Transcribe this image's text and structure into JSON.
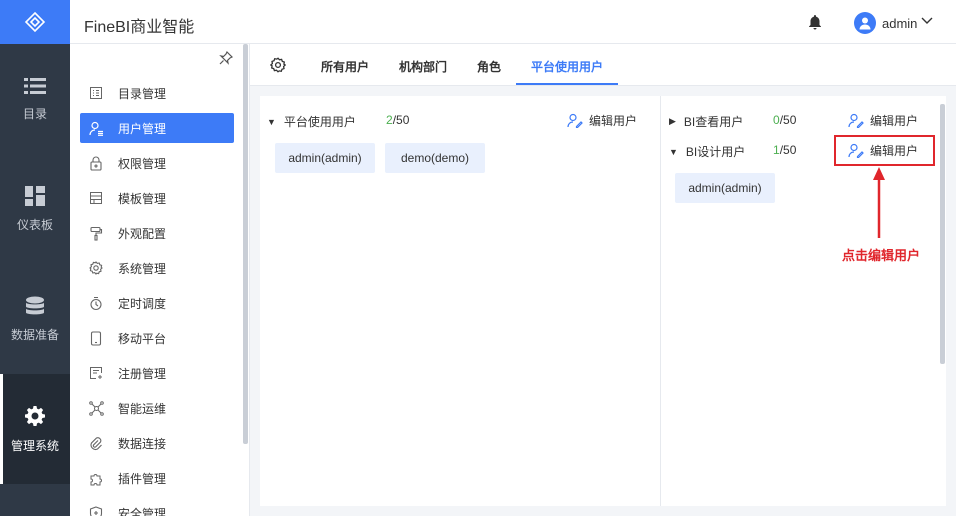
{
  "app": {
    "title": "FineBI商业智能"
  },
  "header": {
    "username": "admin"
  },
  "leftnav": [
    {
      "label": "目录",
      "icon": "list-icon"
    },
    {
      "label": "仪表板",
      "icon": "dashboard-icon"
    },
    {
      "label": "数据准备",
      "icon": "database-icon"
    },
    {
      "label": "管理系统",
      "icon": "gear-icon"
    }
  ],
  "subnav": [
    {
      "label": "目录管理",
      "icon": "catalog-icon"
    },
    {
      "label": "用户管理",
      "icon": "user-manage-icon"
    },
    {
      "label": "权限管理",
      "icon": "lock-icon"
    },
    {
      "label": "模板管理",
      "icon": "template-icon"
    },
    {
      "label": "外观配置",
      "icon": "paint-roller-icon"
    },
    {
      "label": "系统管理",
      "icon": "settings-icon"
    },
    {
      "label": "定时调度",
      "icon": "timer-icon"
    },
    {
      "label": "移动平台",
      "icon": "mobile-icon"
    },
    {
      "label": "注册管理",
      "icon": "register-icon"
    },
    {
      "label": "智能运维",
      "icon": "network-icon"
    },
    {
      "label": "数据连接",
      "icon": "link-icon"
    },
    {
      "label": "插件管理",
      "icon": "puzzle-icon"
    },
    {
      "label": "安全管理",
      "icon": "shield-icon"
    }
  ],
  "tabs": [
    "所有用户",
    "机构部门",
    "角色",
    "平台使用用户"
  ],
  "left_panel": {
    "group": "平台使用用户",
    "count_used": "2",
    "count_total": "/50",
    "edit_label": "编辑用户",
    "chips": [
      "admin(admin)",
      "demo(demo)"
    ]
  },
  "right_panel": {
    "groups": [
      {
        "name": "BI查看用户",
        "count_used": "0",
        "count_total": "/50",
        "edit_label": "编辑用户",
        "expanded": false
      },
      {
        "name": "BI设计用户",
        "count_used": "1",
        "count_total": "/50",
        "edit_label": "编辑用户",
        "expanded": true
      }
    ],
    "chips": [
      "admin(admin)"
    ]
  },
  "annotation": {
    "text": "点击编辑用户"
  },
  "colors": {
    "accent": "#3d7bf7",
    "nav_bg": "#2f3946",
    "highlight_red": "#e0262c",
    "count_green": "#4caf50"
  }
}
